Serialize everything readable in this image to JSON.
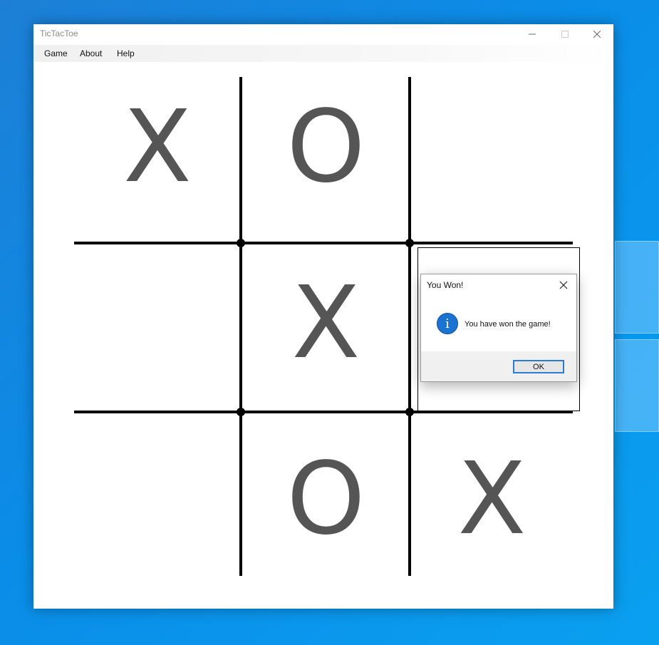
{
  "window": {
    "title": "TicTacToe",
    "controls": {
      "minimize_icon": "minimize-icon",
      "maximize_icon": "maximize-icon",
      "close_icon": "close-icon"
    }
  },
  "menu": {
    "items": [
      {
        "label": "Game"
      },
      {
        "label": "About"
      },
      {
        "label": "Help"
      }
    ]
  },
  "board": {
    "rows": [
      [
        "X",
        "O",
        ""
      ],
      [
        "",
        "X",
        ""
      ],
      [
        "",
        "O",
        "X"
      ]
    ],
    "mark_color": "#555555",
    "grid_color": "#000000"
  },
  "dialog": {
    "title": "You Won!",
    "message": "You have won the game!",
    "icon": "info-icon",
    "icon_glyph": "i",
    "ok_label": "OK",
    "accent_color": "#1a73d1"
  }
}
